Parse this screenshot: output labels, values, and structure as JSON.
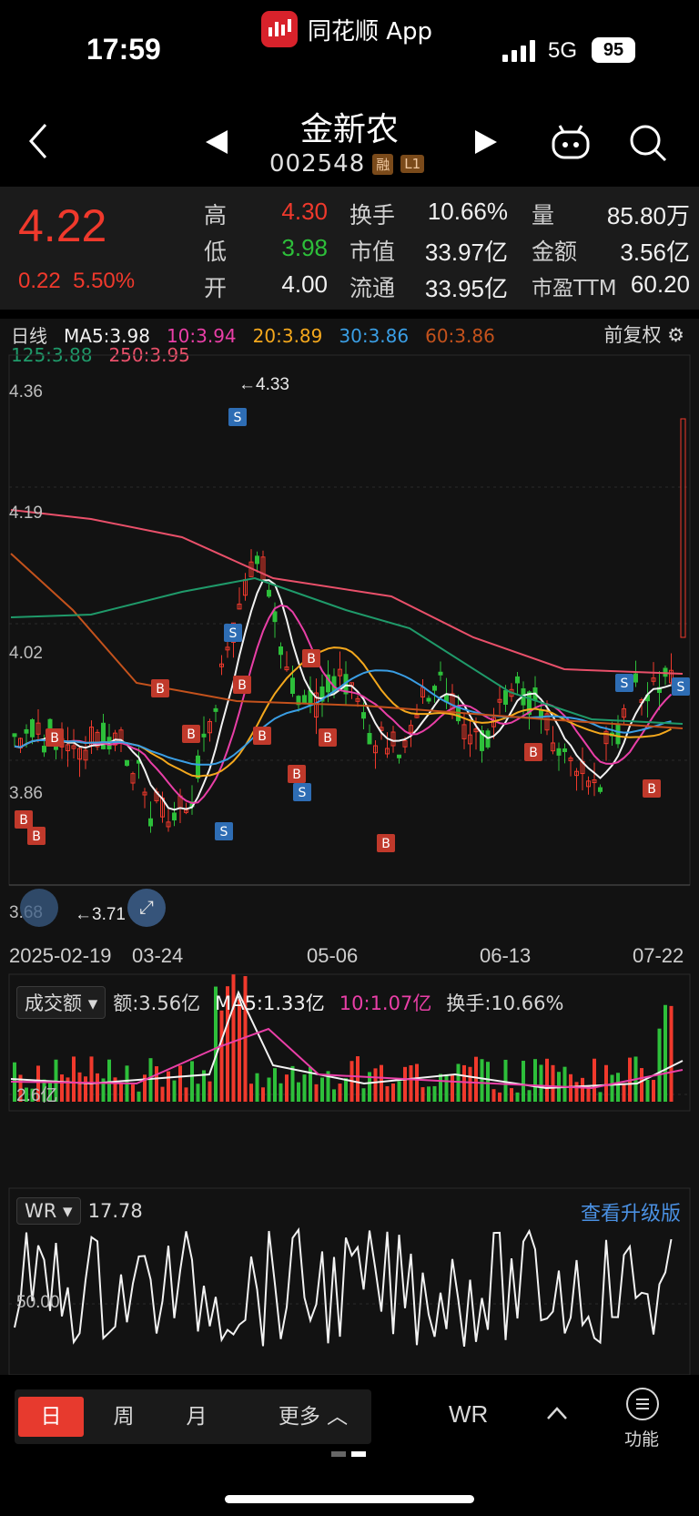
{
  "status": {
    "time": "17:59",
    "app_name": "同花顺 App",
    "network": "5G",
    "battery": "95"
  },
  "nav": {
    "title": "金新农",
    "code": "002548",
    "tag_margin": "融",
    "tag_level": "L1"
  },
  "quote": {
    "price": "4.22",
    "change": "0.22",
    "change_pct": "5.50%",
    "rows": [
      {
        "l1": "高",
        "v1": "4.30",
        "l2": "换手",
        "v2": "10.66%",
        "l3": "量",
        "v3": "85.80万"
      },
      {
        "l1": "低",
        "v1": "3.98",
        "l2": "市值",
        "v2": "33.97亿",
        "l3": "金额",
        "v3": "3.56亿"
      },
      {
        "l1": "开",
        "v1": "4.00",
        "l2": "流通",
        "v2": "33.95亿",
        "l3": "市盈TTM",
        "v3": "60.20"
      }
    ]
  },
  "ma_legend": {
    "period": "日线",
    "ma5": "MA5:3.98",
    "ma10": "10:3.94",
    "ma20": "20:3.89",
    "ma30": "30:3.86",
    "ma60": "60:3.86",
    "ma125": "125:3.88",
    "ma250": "250:3.95",
    "adjust": "前复权"
  },
  "price_axis": {
    "y1": "4.36",
    "y2": "4.19",
    "y3": "4.02",
    "y4": "3.86",
    "y5": "3.68"
  },
  "annotations": {
    "high": "←4.33",
    "low": "←3.71"
  },
  "dates": {
    "d1": "2025-02-19",
    "d2": "03-24",
    "d3": "05-06",
    "d4": "06-13",
    "d5": "07-22"
  },
  "volume": {
    "selector": "成交额",
    "amount": "额:3.56亿",
    "ma5": "MA5:1.33亿",
    "ma10": "10:1.07亿",
    "turnover": "换手:10.66%",
    "axis": "2.6亿"
  },
  "wr": {
    "selector": "WR",
    "value": "17.78",
    "axis": "50.00",
    "upgrade": "查看升级版"
  },
  "bottom": {
    "day": "日",
    "week": "周",
    "month": "月",
    "more": "更多",
    "indicator": "WR",
    "func": "功能"
  },
  "colors": {
    "up": "#f0392c",
    "down": "#2dbf3a",
    "ma5": "#f2f2f2",
    "ma10": "#e93fa7",
    "ma20": "#f4a81d",
    "ma30": "#3a9ee4",
    "ma60": "#c4521c",
    "ma125": "#1f9a6a",
    "ma250": "#e9506a"
  }
}
